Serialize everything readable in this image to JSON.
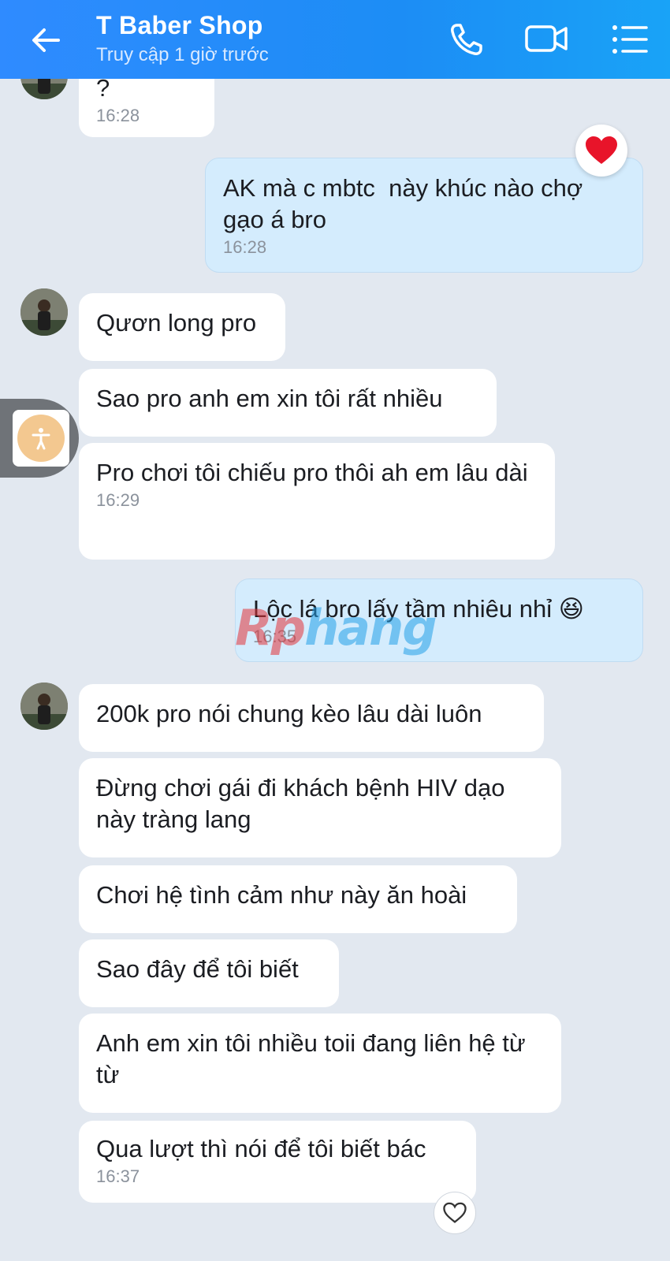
{
  "header": {
    "title": "T Baber Shop",
    "status": "Truy cập 1 giờ trước",
    "icons": [
      "back-arrow-icon",
      "phone-icon",
      "video-camera-icon",
      "list-menu-icon"
    ]
  },
  "colors": {
    "header_start": "#2f8bff",
    "header_end": "#19a3f7",
    "background": "#e2e8f0",
    "incoming_bubble": "#ffffff",
    "outgoing_bubble": "#d4ecfd"
  },
  "messages": [
    {
      "side": "in",
      "text": "?",
      "time": "16:28"
    },
    {
      "side": "out",
      "text": "AK mà c mbtc  này khúc nào chợ gạo á bro",
      "time": "16:28",
      "reaction": "heart-icon"
    },
    {
      "side": "in",
      "text": "Qươn long pro"
    },
    {
      "side": "in",
      "text": "Sao pro anh em xin tôi rất nhiều"
    },
    {
      "side": "in",
      "text": "Pro chơi tôi chiếu pro thôi ah em lâu dài",
      "time": "16:29"
    },
    {
      "side": "out",
      "text": "Lộc lá bro lấy tầm nhiêu nhỉ 😆",
      "time": "16:35"
    },
    {
      "side": "in",
      "text": "200k pro nói chung kèo lâu dài luôn"
    },
    {
      "side": "in",
      "text": "Đừng chơi gái đi khách bệnh HIV dạo này tràng lang"
    },
    {
      "side": "in",
      "text": "Chơi hệ tình cảm như này ăn hoài"
    },
    {
      "side": "in",
      "text": "Sao đây để tôi biết"
    },
    {
      "side": "in",
      "text": "Anh em xin tôi nhiều toii đang liên hệ từ từ"
    },
    {
      "side": "in",
      "text": "Qua lượt thì nói để tôi biết bác",
      "time": "16:37"
    }
  ],
  "watermark": {
    "part1": "Rp",
    "part2": "hang"
  }
}
